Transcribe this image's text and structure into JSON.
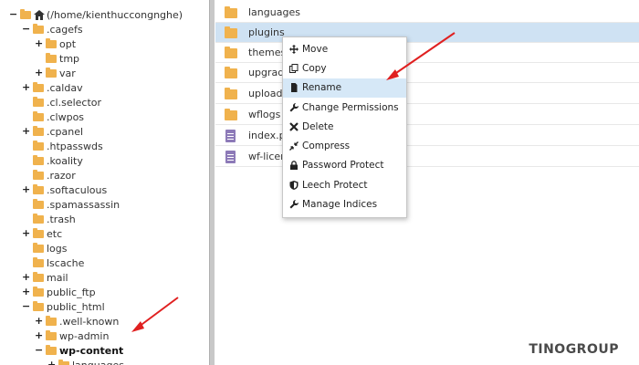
{
  "tree": {
    "root_label": "(/home/kienthuccongnghe)",
    "items": [
      {
        "label": ".cagefs",
        "toggle": "−"
      },
      {
        "label": "opt",
        "toggle": "+"
      },
      {
        "label": "tmp",
        "toggle": ""
      },
      {
        "label": "var",
        "toggle": "+"
      },
      {
        "label": ".caldav",
        "toggle": "+"
      },
      {
        "label": ".cl.selector",
        "toggle": ""
      },
      {
        "label": ".clwpos",
        "toggle": ""
      },
      {
        "label": ".cpanel",
        "toggle": "+"
      },
      {
        "label": ".htpasswds",
        "toggle": ""
      },
      {
        "label": ".koality",
        "toggle": ""
      },
      {
        "label": ".razor",
        "toggle": ""
      },
      {
        "label": ".softaculous",
        "toggle": "+"
      },
      {
        "label": ".spamassassin",
        "toggle": ""
      },
      {
        "label": ".trash",
        "toggle": ""
      },
      {
        "label": "etc",
        "toggle": "+"
      },
      {
        "label": "logs",
        "toggle": ""
      },
      {
        "label": "lscache",
        "toggle": ""
      },
      {
        "label": "mail",
        "toggle": "+"
      },
      {
        "label": "public_ftp",
        "toggle": "+"
      },
      {
        "label": "public_html",
        "toggle": "−"
      },
      {
        "label": ".well-known",
        "toggle": "+"
      },
      {
        "label": "wp-admin",
        "toggle": "+"
      },
      {
        "label": "wp-content",
        "toggle": "−"
      },
      {
        "label": "languages",
        "toggle": "+"
      }
    ]
  },
  "files": [
    {
      "name": "languages",
      "type": "folder"
    },
    {
      "name": "plugins",
      "type": "folder"
    },
    {
      "name": "themes",
      "type": "folder"
    },
    {
      "name": "upgrade",
      "type": "folder"
    },
    {
      "name": "uploads",
      "type": "folder"
    },
    {
      "name": "wflogs",
      "type": "folder"
    },
    {
      "name": "index.ph",
      "type": "file"
    },
    {
      "name": "wf-licen",
      "type": "file"
    }
  ],
  "context_menu": {
    "items": [
      {
        "label": "Move",
        "icon": "move-icon"
      },
      {
        "label": "Copy",
        "icon": "copy-icon"
      },
      {
        "label": "Rename",
        "icon": "file-icon"
      },
      {
        "label": "Change Permissions",
        "icon": "wrench-icon"
      },
      {
        "label": "Delete",
        "icon": "x-icon"
      },
      {
        "label": "Compress",
        "icon": "compress-icon"
      },
      {
        "label": "Password Protect",
        "icon": "lock-icon"
      },
      {
        "label": "Leech Protect",
        "icon": "shield-icon"
      },
      {
        "label": "Manage Indices",
        "icon": "wrench-icon"
      }
    ]
  },
  "brand": "TINOGROUP",
  "colors": {
    "folder": "#f0b24d",
    "selection": "#cfe2f3",
    "arrow": "#e02020"
  }
}
